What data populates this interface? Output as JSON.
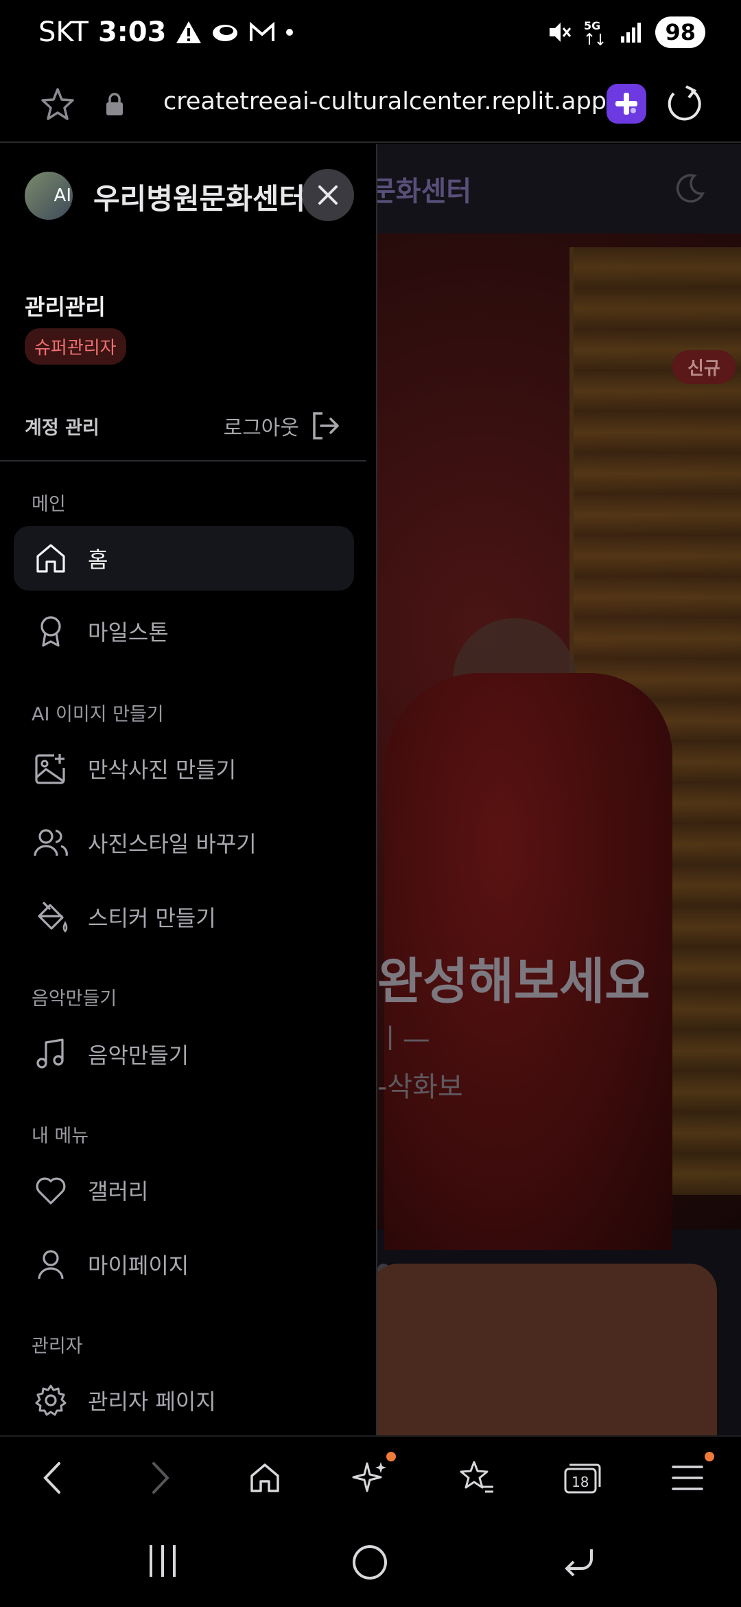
{
  "status_bar": {
    "carrier": "SKT",
    "time": "3:03",
    "battery": "98"
  },
  "browser": {
    "url": "createtreeai-culturalcenter.replit.app"
  },
  "background_page": {
    "header_title": "문화센터",
    "new_badge": "신규",
    "hero_title": "완성해보세요",
    "hero_sub1": "ㅣ—",
    "hero_sub2": "-삭화보"
  },
  "drawer": {
    "logo_text": "AI",
    "title": "우리병원문화센터",
    "user_name": "관리관리",
    "role": "슈퍼관리자",
    "account_label": "계정 관리",
    "logout_label": "로그아웃",
    "sections": [
      {
        "label": "메인"
      },
      {
        "label": "AI 이미지 만들기"
      },
      {
        "label": "음악만들기"
      },
      {
        "label": "내 메뉴"
      },
      {
        "label": "관리자"
      }
    ],
    "items": {
      "home": "홈",
      "milestone": "마일스톤",
      "maternity_photo": "만삭사진 만들기",
      "photo_style": "사진스타일 바꾸기",
      "sticker": "스티커 만들기",
      "music": "음악만들기",
      "gallery": "갤러리",
      "mypage": "마이페이지",
      "admin_page": "관리자 페이지"
    }
  },
  "bottom_bar": {
    "tabs_count": "18"
  },
  "colors": {
    "accent_red": "#f07070",
    "notification_dot": "#f07a3a",
    "assistant_icon": "#6c3ae0"
  }
}
